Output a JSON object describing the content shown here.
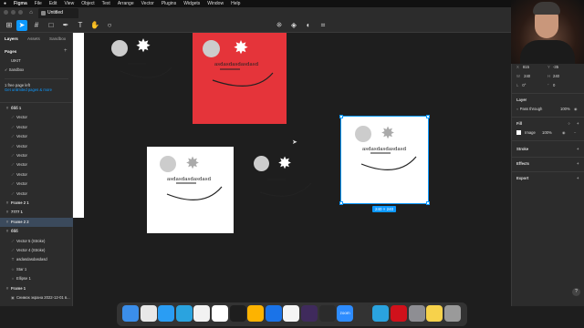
{
  "menubar": {
    "items": [
      "Figma",
      "File",
      "Edit",
      "View",
      "Object",
      "Text",
      "Arrange",
      "Vector",
      "Plugins",
      "Widgets",
      "Window",
      "Help"
    ],
    "right_text": ""
  },
  "tabs": {
    "home_icon": "home-icon",
    "file_tab": "Untitled"
  },
  "toolbar": {
    "tools": [
      "menu-icon",
      "move-icon",
      "frame-icon",
      "shape-icon",
      "pen-icon",
      "text-icon",
      "hand-icon",
      "comment-icon"
    ],
    "right_tools": [
      "component-icon",
      "mask-icon",
      "contrast-icon",
      "crop-icon"
    ]
  },
  "left_panel": {
    "tabs": [
      "Layers",
      "Assets",
      "Sandbox"
    ],
    "pages_label": "Pages",
    "pages": [
      "UIKIT",
      "Sandbox"
    ],
    "notice_title": "1 free page left",
    "notice_link": "Get unlimited pages & more",
    "layers": [
      {
        "label": "ббб 1",
        "type": "frame",
        "indent": 0
      },
      {
        "label": "Vector",
        "type": "vector",
        "indent": 1
      },
      {
        "label": "Vector",
        "type": "vector",
        "indent": 1
      },
      {
        "label": "Vector",
        "type": "vector",
        "indent": 1
      },
      {
        "label": "Vector",
        "type": "vector",
        "indent": 1
      },
      {
        "label": "Vector",
        "type": "vector",
        "indent": 1
      },
      {
        "label": "Vector",
        "type": "vector",
        "indent": 1
      },
      {
        "label": "Vector",
        "type": "vector",
        "indent": 1
      },
      {
        "label": "Vector",
        "type": "vector",
        "indent": 1
      },
      {
        "label": "Vector",
        "type": "vector",
        "indent": 1
      },
      {
        "label": "Frame 2 1",
        "type": "frame",
        "indent": 0
      },
      {
        "label": "7777 1",
        "type": "frame",
        "indent": 0
      },
      {
        "label": "Frame 2 2",
        "type": "frame",
        "indent": 0,
        "selected": true
      },
      {
        "label": "ббб",
        "type": "frame",
        "indent": 0
      },
      {
        "label": "Vector 5 (Stroke)",
        "type": "vector",
        "indent": 1
      },
      {
        "label": "Vector 4 (Stroke)",
        "type": "vector",
        "indent": 1
      },
      {
        "label": "asdasdasdasdasd",
        "type": "text",
        "indent": 1
      },
      {
        "label": "Star 1",
        "type": "star",
        "indent": 1
      },
      {
        "label": "Ellipse 1",
        "type": "ellipse",
        "indent": 1
      },
      {
        "label": "Frame 1",
        "type": "frame",
        "indent": 0
      },
      {
        "label": "Снимок экрана 2022-12-01 в...",
        "type": "image",
        "indent": 1
      }
    ]
  },
  "canvas": {
    "frame_text": "asdasdasdasdasd",
    "selection_size": "240 × 240",
    "colors": {
      "red": "#e5343a",
      "white": "#ffffff",
      "selection": "#0d99ff",
      "grey_circle": "#cccccc"
    }
  },
  "right_panel": {
    "x_label": "X",
    "x_value": "815",
    "y_label": "Y",
    "y_value": "-35",
    "w_label": "W",
    "w_value": "240",
    "h_label": "H",
    "h_value": "240",
    "rotation_label": "L",
    "rotation_value": "0°",
    "radius_value": "0",
    "layer_title": "Layer",
    "blend_mode": "Pass through",
    "layer_opacity": "100%",
    "fill_title": "Fill",
    "fill_type": "Image",
    "fill_opacity": "100%",
    "stroke_title": "Stroke",
    "effects_title": "Effects",
    "export_title": "Export"
  },
  "dock": {
    "apps": [
      {
        "name": "finder-icon",
        "color": "#3b8eea"
      },
      {
        "name": "chrome-icon",
        "color": "#e8e8e8"
      },
      {
        "name": "safari-icon",
        "color": "#2a9df4"
      },
      {
        "name": "telegram-icon",
        "color": "#2aa3df"
      },
      {
        "name": "sketch-icon",
        "color": "#f2f2f2"
      },
      {
        "name": "notion-icon",
        "color": "#ffffff"
      },
      {
        "name": "figma-icon",
        "color": "#1e1e1e"
      },
      {
        "name": "sketch2-icon",
        "color": "#fdb300"
      },
      {
        "name": "onepassword-icon",
        "color": "#1a73e8"
      },
      {
        "name": "photos-icon",
        "color": "#f5f5f5"
      },
      {
        "name": "affinity-icon",
        "color": "#3f2a5c"
      },
      {
        "name": "finalcut-icon",
        "color": "#2b2b2b"
      },
      {
        "name": "zoom-icon",
        "color": "#2d8cff"
      },
      {
        "name": "davinci-icon",
        "color": "#333333"
      },
      {
        "name": "telegram2-icon",
        "color": "#2aa3df"
      },
      {
        "name": "opera-icon",
        "color": "#d0111b"
      },
      {
        "name": "settings-icon",
        "color": "#8e8e93"
      },
      {
        "name": "notes-icon",
        "color": "#f7d24b"
      },
      {
        "name": "trash-icon",
        "color": "#9a9a9a"
      }
    ],
    "zoom_label": "zoom"
  }
}
